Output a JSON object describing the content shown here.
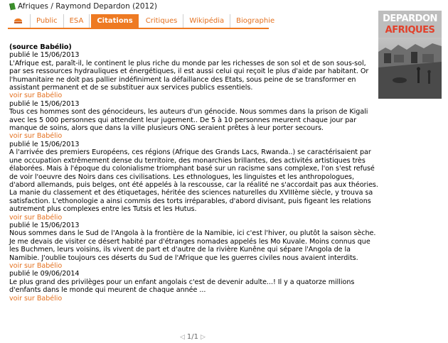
{
  "header": {
    "title": "Afriques / Raymond Depardon (2012)",
    "book_icon": "green-book-icon"
  },
  "tabs": [
    {
      "label": "",
      "icon": "home-icon"
    },
    {
      "label": "Public"
    },
    {
      "label": "ESA"
    },
    {
      "label": "Citations",
      "active": true
    },
    {
      "label": "Critiques"
    },
    {
      "label": "Wikipédia"
    },
    {
      "label": "Biographie"
    }
  ],
  "cover": {
    "title_top": "DEPARDON",
    "title_bottom": "AFRIQUES"
  },
  "source_label": "(source Babélio)",
  "quotes": [
    {
      "date": "publié le 15/06/2013",
      "text": "L'Afrique est, paraît-il, le continent le plus riche du monde par les richesses de son sol et de son sous-sol, par ses ressources hydrauliques et énergétiques, il est aussi celui qui reçoit le plus d'aide par habitant. Or l'humanitaire ne doit pas pallier indéfiniment la défaillance des Etats, sous peine de se transformer en assistant permanent et de se substituer aux services publics essentiels.",
      "link": "voir sur Babélio"
    },
    {
      "date": "publié le 15/06/2013",
      "text": "Tous ces hommes sont des génocideurs, les auteurs d'un génocide. Nous sommes dans la prison de Kigali avec les 5 000 personnes qui attendent leur jugement.. De 5 à 10 personnes meurent chaque jour par manque de soins, alors que dans la ville plusieurs ONG seraient prêtes à leur porter secours.",
      "link": "voir sur Babélio"
    },
    {
      "date": "publié le 15/06/2013",
      "text": "A l'arrivée des premiers Européens, ces régions (Afrique des Grands Lacs, Rwanda..) se caractérisaient par une occupation extrêmement dense du territoire, des monarchies brillantes, des activités artistiques très élaborées. Mais à l'époque du colonialisme triomphant basé sur un racisme sans complexe, l'on s'est refusé de voir l'oeuvre des Noirs dans ces civilisations. Les ethnologues, les linguistes et les anthropologues, d'abord allemands, puis belges, ont été appelés à la rescousse, car la réalité ne s'accordait pas aux théories. La manie du classement et des étiquetages, héritée des sciences naturelles du XVIIIème siècle, y trouva sa satisfaction. L'ethonologie a ainsi commis des torts irréparables, d'abord divisant, puis figeant les relations autrement plus complexes entre les Tutsis et les Hutus.",
      "link": "voir sur Babélio"
    },
    {
      "date": "publié le 15/06/2013",
      "text": "Nous sommes dans le Sud de l'Angola à la frontière de la Namibie, ici c'est l'hiver, ou plutôt la saison sèche. Je me devais de visiter ce désert habité par d'étranges nomades appelés les Mo Kuvale. Moins connus que les Buchmen, leurs voisins, ils vivent de part et d'autre de la rivière Kunêne qui sépare l'Angola de la Namibie. J'oublie toujours ces déserts du Sud de l'Afrique que les guerres civiles nous avaient interdits.",
      "link": "voir sur Babélio"
    },
    {
      "date": "publié le 09/06/2014",
      "text": "Le plus grand des privilèges pour un enfant angolais c'est de devenir adulte...! Il y a quatorze millions d'enfants dans le monde qui meurent de chaque année ...",
      "link": "voir sur Babélio"
    }
  ],
  "pager": {
    "label": "1/1",
    "prev_icon": "triangle-left-icon",
    "next_icon": "triangle-right-icon"
  },
  "colors": {
    "accent": "#ee7a22",
    "link": "#e4701e"
  }
}
